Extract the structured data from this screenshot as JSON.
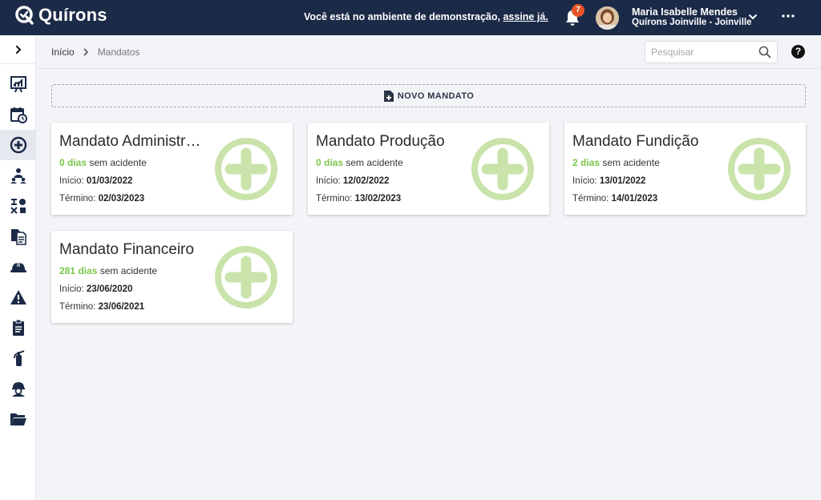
{
  "topbar": {
    "logo_text": "Quírons",
    "demo_text": "Você está no ambiente de demonstração, ",
    "demo_link": "assine já.",
    "notifications_count": "7",
    "user_name": "Maria Isabelle Mendes",
    "user_org": "Quírons Joinville - Joinville"
  },
  "breadcrumb": {
    "home": "Início",
    "current": "Mandatos"
  },
  "search": {
    "placeholder": "Pesquisar"
  },
  "help_label": "?",
  "new_button": {
    "label": "NOVO MANDATO"
  },
  "sidebar": {
    "items": [
      {
        "icon": "dashboard-icon"
      },
      {
        "icon": "calendar-clock-icon"
      },
      {
        "icon": "plus-circle-icon",
        "active": true
      },
      {
        "icon": "org-chart-icon"
      },
      {
        "icon": "puzzle-icon"
      },
      {
        "icon": "documents-icon"
      },
      {
        "icon": "helmet-icon"
      },
      {
        "icon": "warning-icon"
      },
      {
        "icon": "clipboard-icon"
      },
      {
        "icon": "fire-extinguisher-icon"
      },
      {
        "icon": "worker-icon"
      },
      {
        "icon": "folder-icon"
      }
    ]
  },
  "cards": [
    {
      "title": "Mandato Administrativo",
      "days_value": "0 dias",
      "days_suffix": " sem acidente",
      "start_label": "Início: ",
      "start": "01/03/2022",
      "end_label": "Término: ",
      "end": "02/03/2023"
    },
    {
      "title": "Mandato Produção",
      "days_value": "0 dias",
      "days_suffix": " sem acidente",
      "start_label": "Início: ",
      "start": "12/02/2022",
      "end_label": "Término: ",
      "end": "13/02/2023"
    },
    {
      "title": "Mandato Fundição",
      "days_value": "2 dias",
      "days_suffix": " sem acidente",
      "start_label": "Início: ",
      "start": "13/01/2022",
      "end_label": "Término: ",
      "end": "14/01/2023"
    },
    {
      "title": "Mandato Financeiro",
      "days_value": "281 dias",
      "days_suffix": " sem acidente",
      "start_label": "Início: ",
      "start": "23/06/2020",
      "end_label": "Término: ",
      "end": "23/06/2021"
    }
  ],
  "colors": {
    "topbar": "#1b2a47",
    "accent_green": "#7cc64a",
    "plus_green": "#c9e3aa",
    "badge": "#e8542a"
  }
}
